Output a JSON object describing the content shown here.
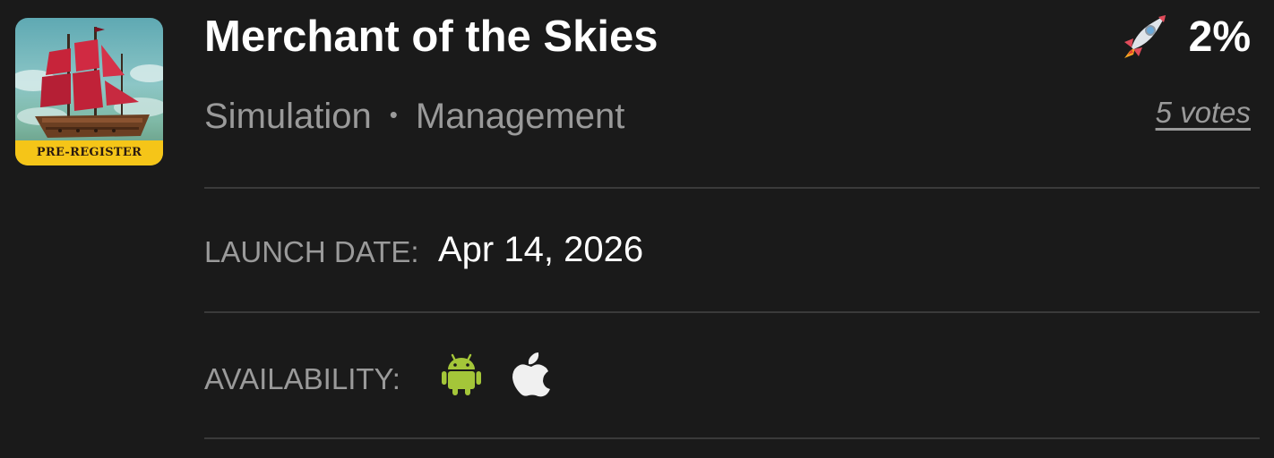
{
  "game": {
    "title": "Merchant of the Skies",
    "genres": [
      "Simulation",
      "Management"
    ],
    "genre_separator": "•",
    "icon_banner": "PRE-REGISTER"
  },
  "rating": {
    "icon": "rocket-icon",
    "percent": "2%",
    "votes_label": "5 votes"
  },
  "details": {
    "launch_date_label": "LAUNCH DATE:",
    "launch_date_value": "Apr 14, 2026",
    "availability_label": "AVAILABILITY:",
    "platforms": [
      {
        "icon": "android-icon",
        "color": "#a4c639"
      },
      {
        "icon": "apple-icon",
        "color": "#f0f0f0"
      }
    ]
  },
  "colors": {
    "background": "#1a1a1a",
    "muted_text": "#9a9a9a",
    "divider": "#3a3a3a",
    "banner": "#f5c518"
  }
}
